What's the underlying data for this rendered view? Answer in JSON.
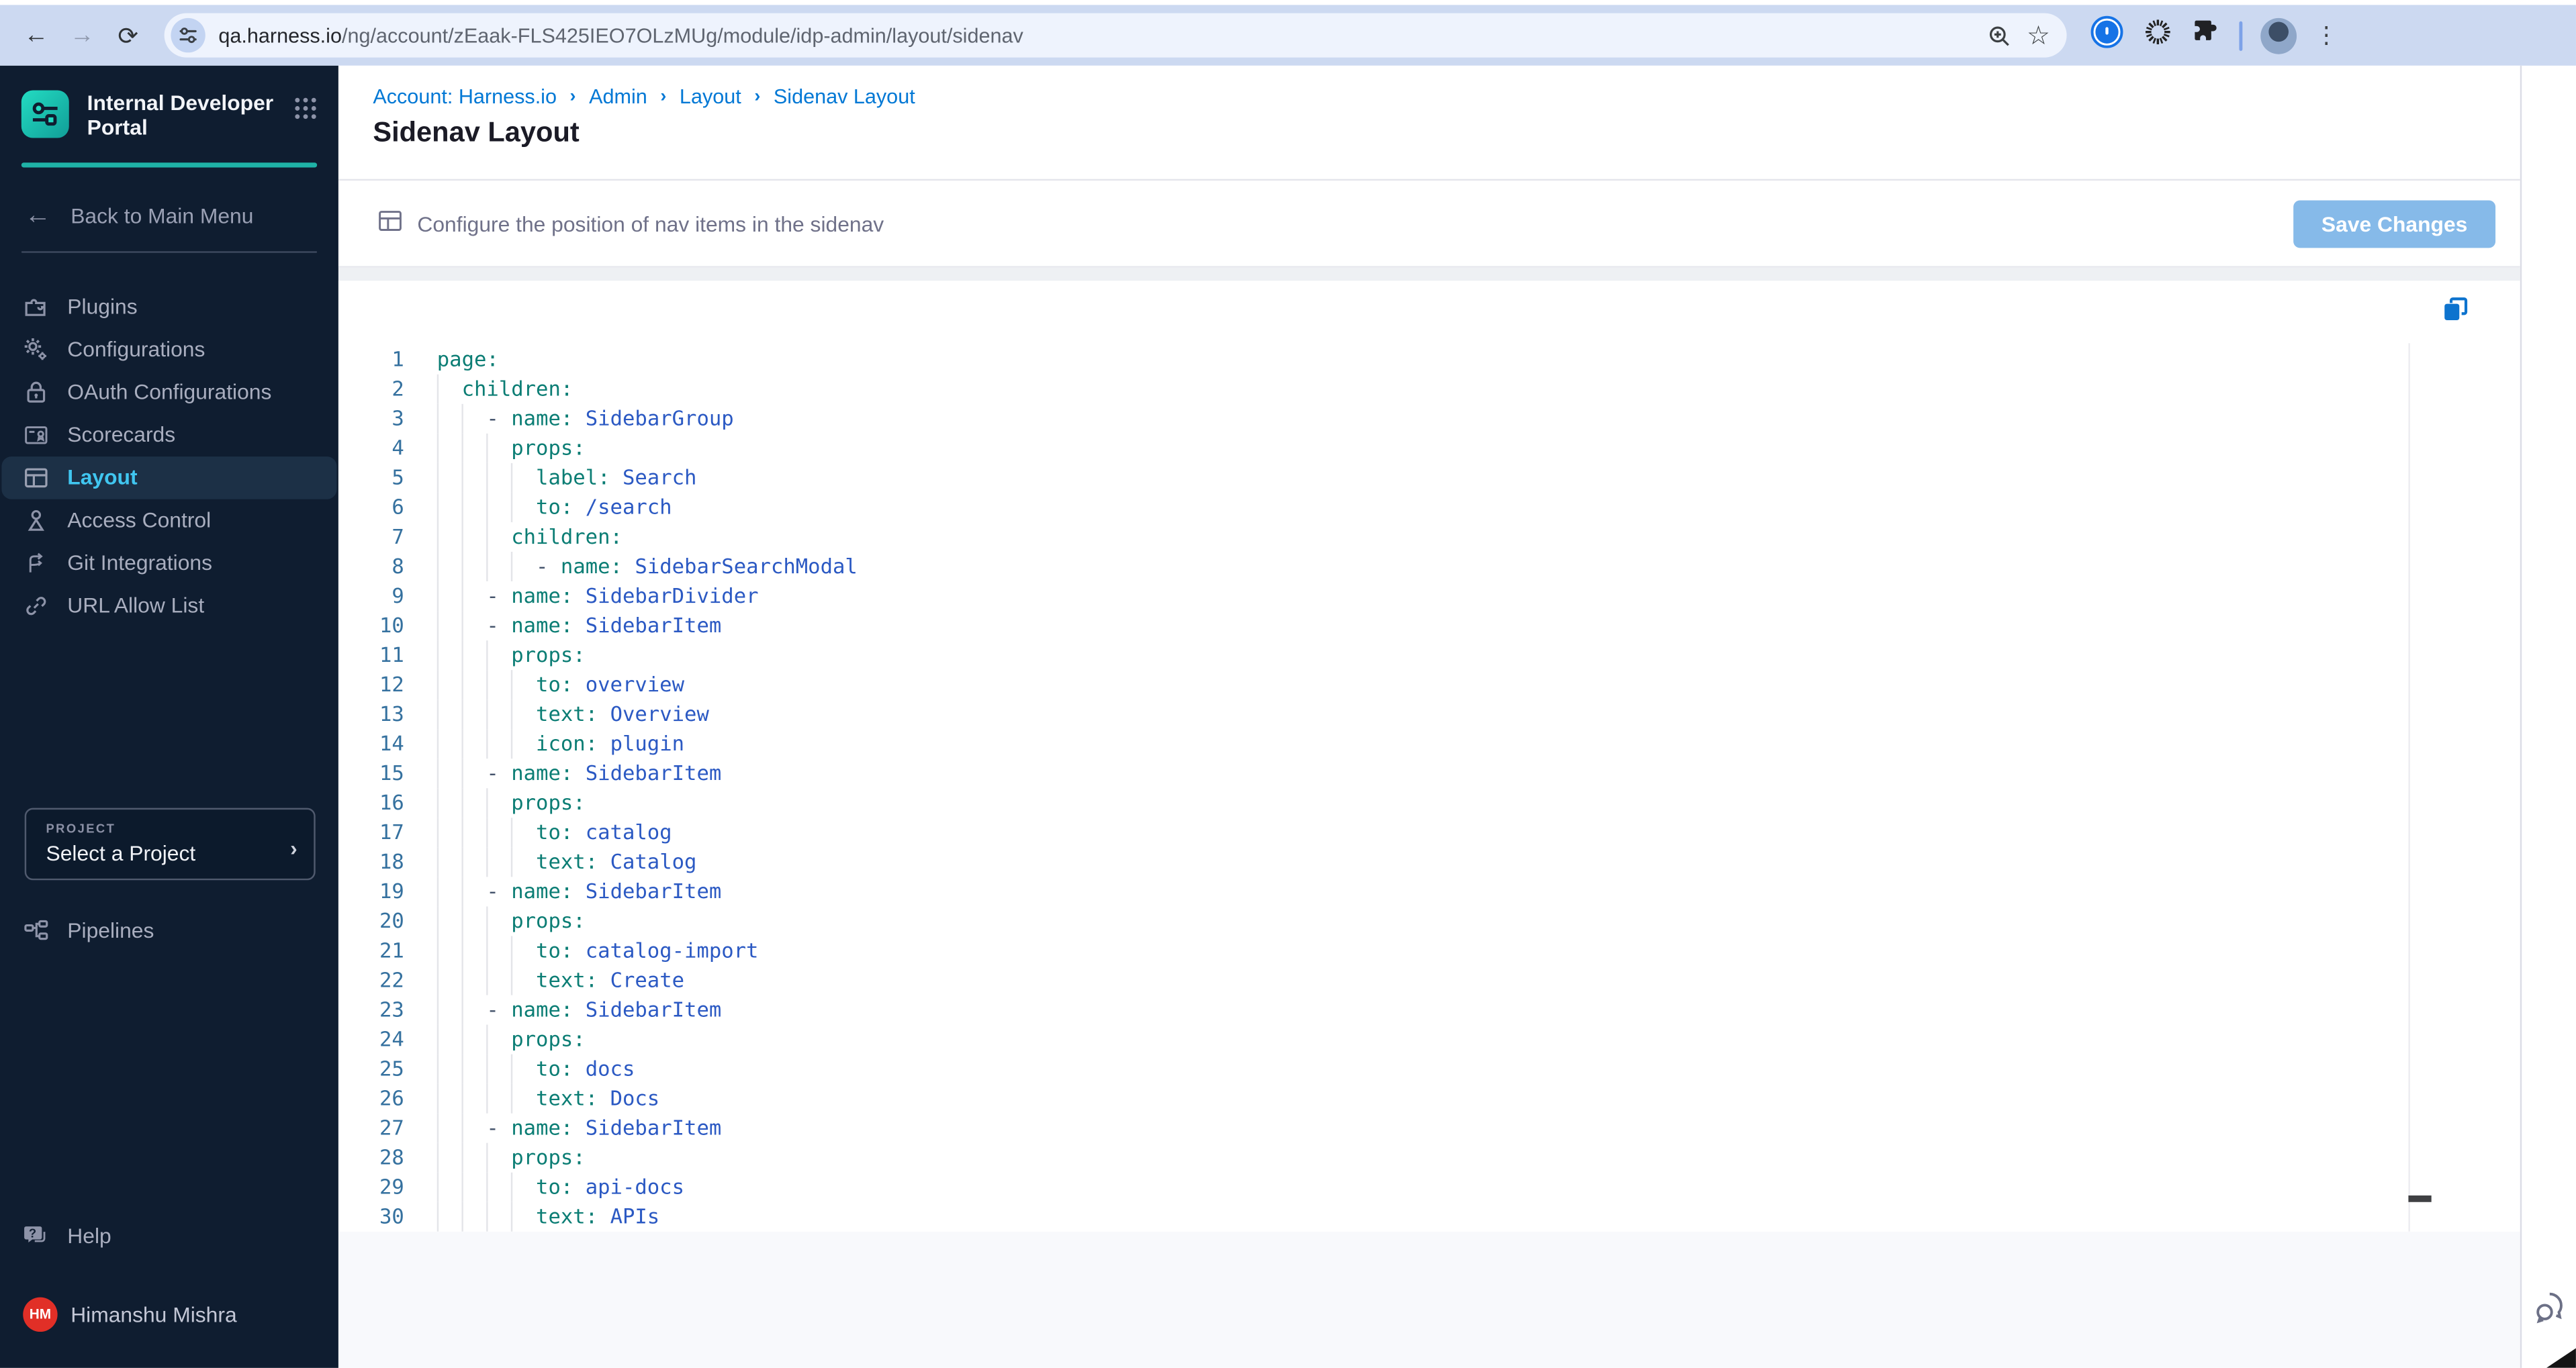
{
  "browser": {
    "url_domain": "qa.harness.io",
    "url_path": "/ng/account/zEaak-FLS425IEO7OLzMUg/module/idp-admin/layout/sidenav",
    "icons": [
      "back-icon",
      "forward-icon",
      "reload-icon",
      "site-info-tune-icon",
      "zoom-icon",
      "bookmark-star-icon",
      "password-manager-icon",
      "extension-spinner-icon",
      "extensions-puzzle-icon",
      "profile-avatar",
      "menu-kebab-icon"
    ],
    "back_glyph": "←",
    "forward_glyph": "→",
    "reload_glyph": "⟳",
    "star_glyph": "☆",
    "kebab_glyph": "⋮"
  },
  "sidebar": {
    "brand": "Internal Developer Portal",
    "back_label": "Back to Main Menu",
    "back_glyph": "←",
    "items": [
      {
        "label": "Plugins",
        "icon": "puzzle-icon",
        "selected": false
      },
      {
        "label": "Configurations",
        "icon": "gears-icon",
        "selected": false
      },
      {
        "label": "OAuth Configurations",
        "icon": "lock-icon",
        "selected": false
      },
      {
        "label": "Scorecards",
        "icon": "scorecard-icon",
        "selected": false
      },
      {
        "label": "Layout",
        "icon": "layout-icon",
        "selected": true
      },
      {
        "label": "Access Control",
        "icon": "person-icon",
        "selected": false
      },
      {
        "label": "Git Integrations",
        "icon": "git-branch-icon",
        "selected": false
      },
      {
        "label": "URL Allow List",
        "icon": "link-icon",
        "selected": false
      }
    ],
    "project": {
      "label": "PROJECT",
      "value": "Select a Project",
      "chevron": "›"
    },
    "pipelines": {
      "label": "Pipelines",
      "icon": "pipeline-icon"
    },
    "help": {
      "label": "Help",
      "icon": "chat-question-icon"
    },
    "user": {
      "name": "Himanshu Mishra",
      "initials": "HM",
      "avatar_color": "#e12f27"
    }
  },
  "main": {
    "breadcrumb": [
      "Account: Harness.io",
      "Admin",
      "Layout",
      "Sidenav Layout"
    ],
    "breadcrumb_separator": "›",
    "title": "Sidenav Layout",
    "toolbar": {
      "hint": "Configure the position of nav items in the sidenav",
      "save_label": "Save Changes"
    }
  },
  "editor": {
    "language": "yaml",
    "lines": [
      "page:",
      "  children:",
      "    - name: SidebarGroup",
      "      props:",
      "        label: Search",
      "        to: /search",
      "      children:",
      "        - name: SidebarSearchModal",
      "    - name: SidebarDivider",
      "    - name: SidebarItem",
      "      props:",
      "        to: overview",
      "        text: Overview",
      "        icon: plugin",
      "    - name: SidebarItem",
      "      props:",
      "        to: catalog",
      "        text: Catalog",
      "    - name: SidebarItem",
      "      props:",
      "        to: catalog-import",
      "        text: Create",
      "    - name: SidebarItem",
      "      props:",
      "        to: docs",
      "        text: Docs",
      "    - name: SidebarItem",
      "      props:",
      "        to: api-docs",
      "        text: APIs"
    ]
  },
  "colors": {
    "sidebar_bg": "#0f1d30",
    "sidebar_selected_bg": "#1c3046",
    "sidebar_selected_text": "#40c6f0",
    "teal_accent": "#1fb2a6",
    "breadcrumb_blue": "#0278d5",
    "save_button": "#86bae9",
    "avatar_red": "#e12f27",
    "code_key": "#0b7d74",
    "code_value": "#2b59c3",
    "code_line_number": "#35719f",
    "copy_icon_blue": "#0d73ce",
    "browser_bar": "#ccd9f1"
  }
}
